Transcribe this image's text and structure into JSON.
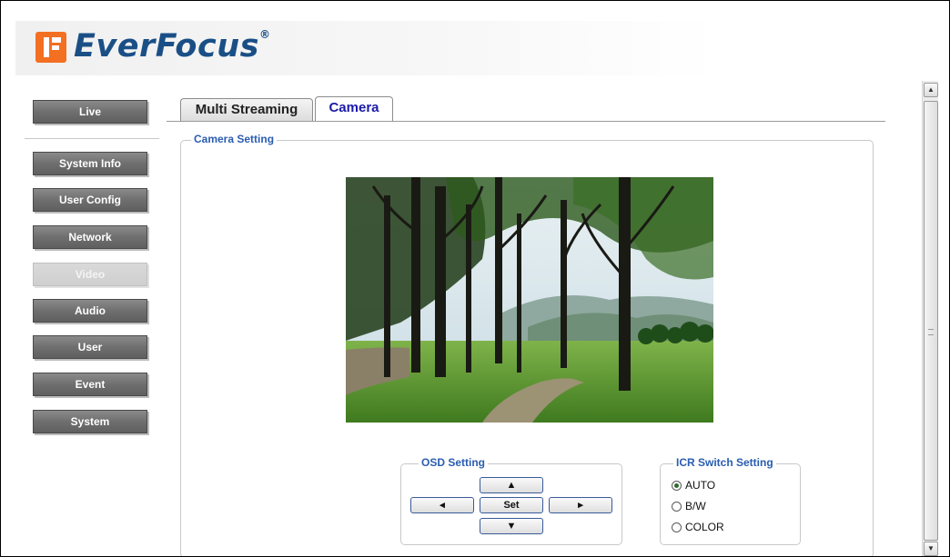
{
  "brand": {
    "logo_text": "EverFocus",
    "reg_mark": "®",
    "accent_color": "#f36f21",
    "text_color": "#1a4f86"
  },
  "sidebar": {
    "items": [
      {
        "label": "Live",
        "active": false
      },
      {
        "label": "System Info",
        "active": false
      },
      {
        "label": "User Config",
        "active": false
      },
      {
        "label": "Network",
        "active": false
      },
      {
        "label": "Video",
        "active": true
      },
      {
        "label": "Audio",
        "active": false
      },
      {
        "label": "User",
        "active": false
      },
      {
        "label": "Event",
        "active": false
      },
      {
        "label": "System",
        "active": false
      }
    ]
  },
  "tabs": [
    {
      "label": "Multi Streaming",
      "selected": false
    },
    {
      "label": "Camera",
      "selected": true
    }
  ],
  "camera_setting": {
    "legend": "Camera Setting",
    "preview_icon": "camera-preview-image"
  },
  "osd_setting": {
    "legend": "OSD Setting",
    "up": "▲",
    "down": "▼",
    "left": "◂",
    "right": "▸",
    "set": "Set"
  },
  "icr_setting": {
    "legend": "ICR Switch Setting",
    "options": [
      {
        "label": "AUTO",
        "checked": true
      },
      {
        "label": "B/W",
        "checked": false
      },
      {
        "label": "COLOR",
        "checked": false
      }
    ]
  },
  "scrollbar": {
    "up_icon": "▲",
    "down_icon": "▼"
  }
}
